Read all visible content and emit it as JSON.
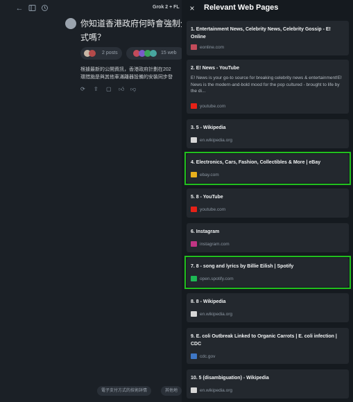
{
  "chat": {
    "topbar_title": "Grok 2 + FL",
    "question_lines": [
      "你知道香港政府何時會強制分",
      "式嗎？"
    ],
    "posts_label": "2 posts",
    "web_label": "15 web",
    "answer_lines": [
      "根據最新的公開資訊，香港政府計劃在202",
      "環措施是與其他車滿離器設備的安裝同步發"
    ],
    "chips": [
      "電子支付方式的技術詳情",
      "其他地"
    ]
  },
  "panel": {
    "title": "Relevant Web Pages",
    "close_glyph": "×",
    "cards": [
      {
        "title": "1. Entertainment News, Celebrity News, Celebrity Gossip - E! Online",
        "description": "",
        "source": "eonline.com",
        "favicon_color": "#c44b5a"
      },
      {
        "title": "2. E! News - YouTube",
        "description": "E! News is your go-to source for breaking celebrity news & entertainment!E! News is the modern-and-bold mood for the pop cultured - brought to life by the di...",
        "source": "youtube.com",
        "favicon_color": "#e62117"
      },
      {
        "title": "3. 5 - Wikipedia",
        "description": "",
        "source": "en.wikipedia.org",
        "favicon_color": "#d7d7d7"
      },
      {
        "title": "4. Electronics, Cars, Fashion, Collectibles & More | eBay",
        "description": "",
        "source": "ebay.com",
        "favicon_color": "#e8b01c"
      },
      {
        "title": "5. 8 - YouTube",
        "description": "",
        "source": "youtube.com",
        "favicon_color": "#e62117"
      },
      {
        "title": "6. Instagram",
        "description": "",
        "source": "instagram.com",
        "favicon_color": "#c13584"
      },
      {
        "title": "7. 8 - song and lyrics by Billie Eilish | Spotify",
        "description": "",
        "source": "open.spotify.com",
        "favicon_color": "#1db954"
      },
      {
        "title": "8. 8 - Wikipedia",
        "description": "",
        "source": "en.wikipedia.org",
        "favicon_color": "#d7d7d7"
      },
      {
        "title": "9. E. coli Outbreak Linked to Organic Carrots | E. coli infection | CDC",
        "description": "",
        "source": "cdc.gov",
        "favicon_color": "#3e77c6"
      },
      {
        "title": "10. 5 (disambiguation) - Wikipedia",
        "description": "",
        "source": "en.wikipedia.org",
        "favicon_color": "#d7d7d7"
      }
    ]
  },
  "highlight_color": "#22c01e"
}
